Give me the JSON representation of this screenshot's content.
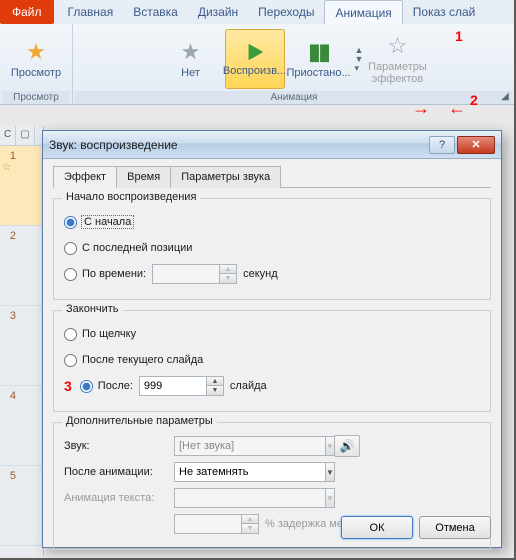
{
  "ribbon": {
    "file": "Файл",
    "tabs": [
      "Главная",
      "Вставка",
      "Дизайн",
      "Переходы",
      "Анимация",
      "Показ слай"
    ],
    "active_index": 4,
    "preview": {
      "label": "Просмотр",
      "group": "Просмотр"
    },
    "anim": {
      "none": "Нет",
      "play": "Воспроизв...",
      "pause": "Приостано...",
      "effect_params": "Параметры\nэффектов",
      "group": "Анимация"
    }
  },
  "annotations": {
    "m1": "1",
    "m2": "2",
    "m3": "3"
  },
  "slides": [
    "1",
    "2",
    "3",
    "4",
    "5"
  ],
  "dialog": {
    "title": "Звук: воспроизведение",
    "tabs": [
      "Эффект",
      "Время",
      "Параметры звука"
    ],
    "start": {
      "legend": "Начало воспроизведения",
      "from_start": "С начала",
      "from_last": "С последней позиции",
      "by_time": "По времени:",
      "seconds": "секунд"
    },
    "end": {
      "legend": "Закончить",
      "on_click": "По щелчку",
      "after_current": "После текущего слайда",
      "after": "После:",
      "after_value": "999",
      "slide": "слайда"
    },
    "extra": {
      "legend": "Дополнительные параметры",
      "sound": "Звук:",
      "sound_value": "[Нет звука]",
      "after_anim": "После анимации:",
      "after_anim_value": "Не затемнять",
      "text_anim": "Анимация текста:",
      "letter_delay": "% задержка между буквами"
    },
    "ok": "ОК",
    "cancel": "Отмена"
  }
}
